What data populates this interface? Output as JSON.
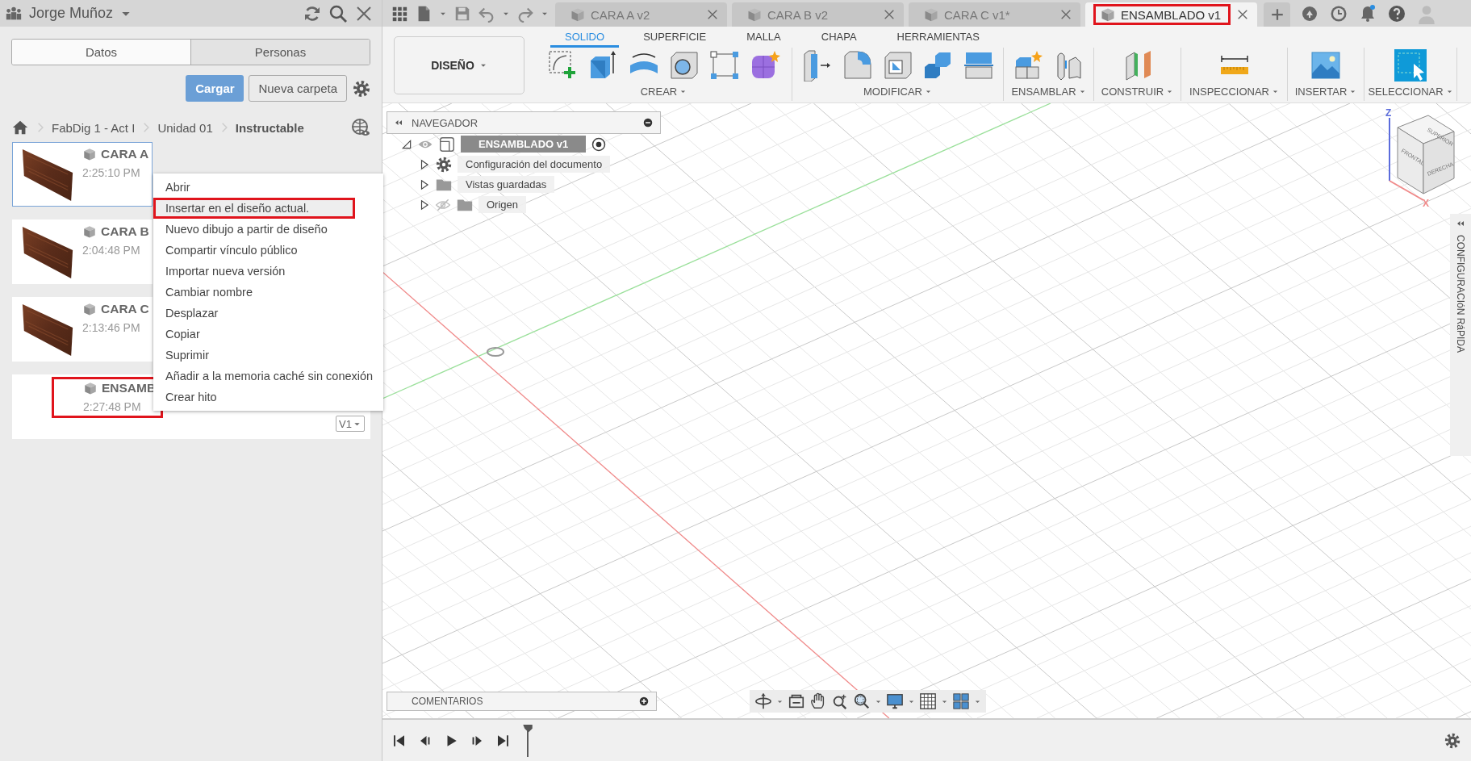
{
  "data_panel": {
    "user": "Jorge Muñoz",
    "tabs": [
      {
        "label": "Datos",
        "selected": true
      },
      {
        "label": "Personas",
        "selected": false
      }
    ],
    "upload_button": "Cargar",
    "new_folder_button": "Nueva carpeta",
    "breadcrumb": [
      "FabDig 1 - Act I",
      "Unidad 01",
      "Instructable"
    ],
    "files": [
      {
        "name": "CARA A",
        "time": "2:25:10 PM",
        "thumbnail": true,
        "selected": true,
        "annotated": false
      },
      {
        "name": "CARA B",
        "time": "2:04:48 PM",
        "thumbnail": true,
        "selected": false,
        "annotated": false
      },
      {
        "name": "CARA C",
        "time": "2:13:46 PM",
        "thumbnail": true,
        "selected": false,
        "annotated": false
      },
      {
        "name": "ENSAMB",
        "time": "2:27:48 PM",
        "thumbnail": false,
        "selected": false,
        "annotated": true,
        "version": "V1"
      }
    ]
  },
  "context_menu": [
    {
      "label": "Abrir",
      "selected": false,
      "annotated": false
    },
    {
      "label": "Insertar en el diseño actual.",
      "selected": true,
      "annotated": true
    },
    {
      "label": "Nuevo dibujo a partir de diseño",
      "selected": false,
      "annotated": false
    },
    {
      "label": "Compartir vínculo público",
      "selected": false,
      "annotated": false
    },
    {
      "label": "Importar nueva versión",
      "selected": false,
      "annotated": false
    },
    {
      "label": "Cambiar nombre",
      "selected": false,
      "annotated": false
    },
    {
      "label": "Desplazar",
      "selected": false,
      "annotated": false
    },
    {
      "label": "Copiar",
      "selected": false,
      "annotated": false
    },
    {
      "label": "Suprimir",
      "selected": false,
      "annotated": false
    },
    {
      "label": "Añadir a la memoria caché sin conexión",
      "selected": false,
      "annotated": false
    },
    {
      "label": "Crear hito",
      "selected": false,
      "annotated": false
    }
  ],
  "document_tabs": [
    {
      "label": "CARA A v2",
      "selected": false,
      "annotated": false
    },
    {
      "label": "CARA B v2",
      "selected": false,
      "annotated": false
    },
    {
      "label": "CARA C v1*",
      "selected": false,
      "annotated": false
    },
    {
      "label": "ENSAMBLADO v1",
      "selected": true,
      "annotated": true
    }
  ],
  "workspace": "DISEÑO",
  "toolbar_tabs": [
    {
      "label": "SOLIDO",
      "selected": true
    },
    {
      "label": "SUPERFICIE",
      "selected": false
    },
    {
      "label": "MALLA",
      "selected": false
    },
    {
      "label": "CHAPA",
      "selected": false
    },
    {
      "label": "HERRAMIENTAS",
      "selected": false
    }
  ],
  "toolbar_groups": [
    "CREAR",
    "MODIFICAR",
    "ENSAMBLAR",
    "CONSTRUIR",
    "INSPECCIONAR",
    "INSERTAR",
    "SELECCIONAR"
  ],
  "navigator": {
    "title": "NAVEGADOR",
    "tree": [
      {
        "label": "ENSAMBLADO v1",
        "kind": "component",
        "visible": true,
        "expanded": true,
        "children": [
          {
            "label": "Configuración del documento",
            "kind": "settings",
            "expanded": false
          },
          {
            "label": "Vistas guardadas",
            "kind": "folder",
            "expanded": false
          },
          {
            "label": "Origen",
            "kind": "folder",
            "visible": false,
            "expanded": false
          }
        ]
      }
    ]
  },
  "viewcube": {
    "faces": [
      "SUPERIOR",
      "FRONTAL",
      "DERECHA"
    ],
    "axes": [
      "Z",
      "X"
    ]
  },
  "quick_settings": "CONFIGURACIóN RáPIDA",
  "comments": "COMENTARIOS"
}
